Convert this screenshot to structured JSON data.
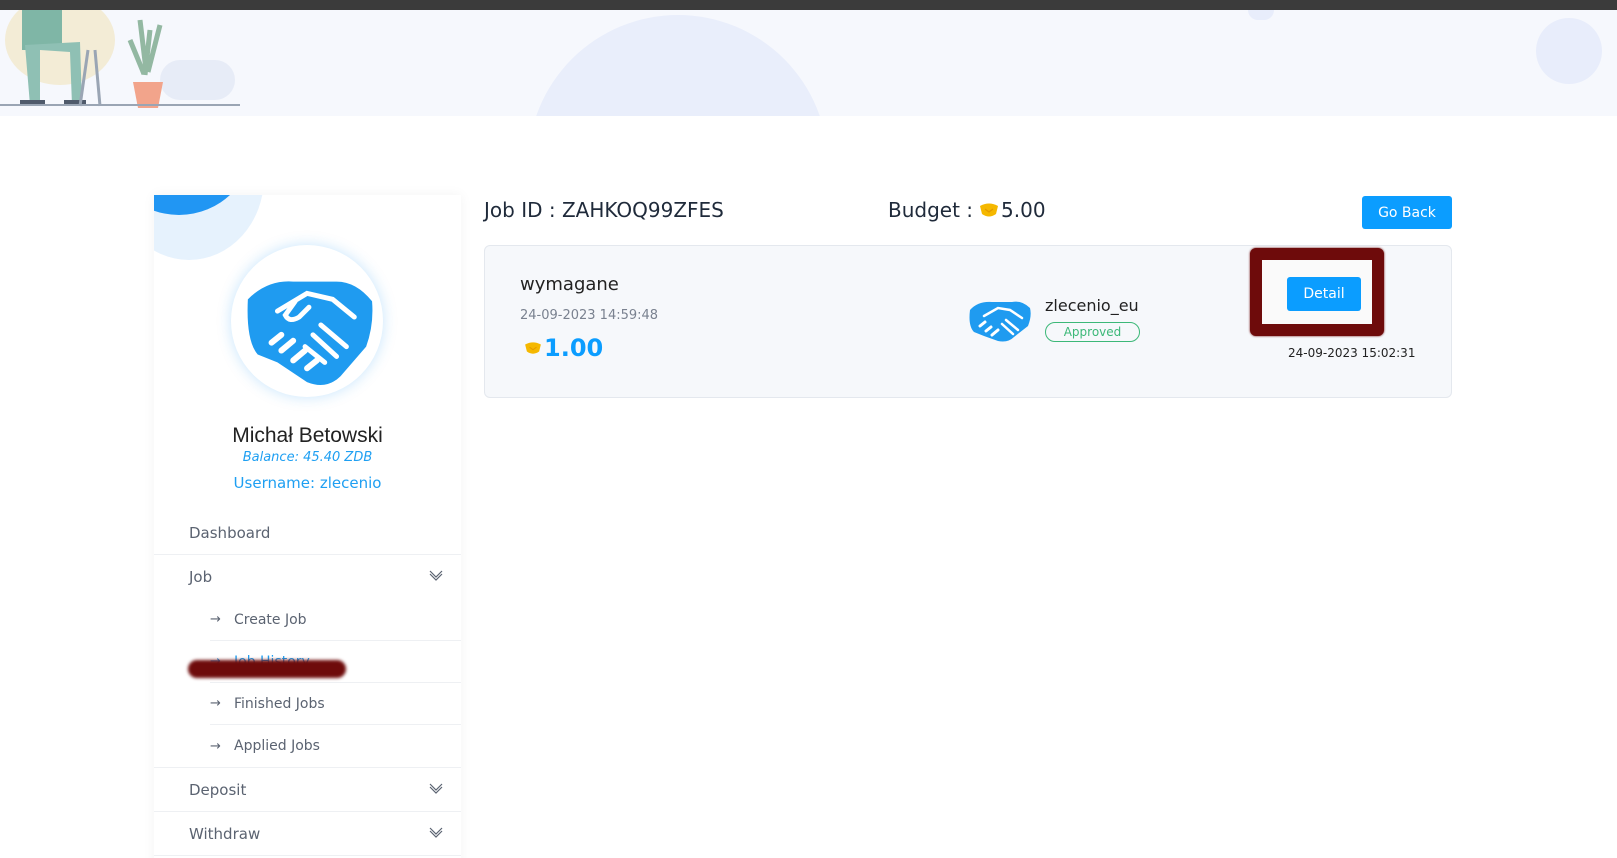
{
  "profile": {
    "name": "Michał Betowski",
    "balance": "Balance: 45.40 ZDB",
    "username": "Username: zlecenio",
    "avatar_icon": "handshake-icon"
  },
  "sidebar": {
    "dashboard": "Dashboard",
    "job": {
      "label": "Job",
      "items": [
        {
          "label": "Create Job",
          "active": false
        },
        {
          "label": "Job History",
          "active": true
        },
        {
          "label": "Finished Jobs",
          "active": false
        },
        {
          "label": "Applied Jobs",
          "active": false
        }
      ]
    },
    "deposit": "Deposit",
    "withdraw": "Withdraw",
    "arrow": "→"
  },
  "header": {
    "job_id": "Job ID : ZAHKOQ99ZFES",
    "budget_label": "Budget :",
    "budget_value": "5.00",
    "go_back": "Go Back"
  },
  "job": {
    "title": "wymagane",
    "date": "24-09-2023 14:59:48",
    "price": "1.00",
    "worker": "zlecenio_eu",
    "status": "Approved",
    "detail_label": "Detail",
    "submitted_at": "24-09-2023 15:02:31"
  },
  "colors": {
    "accent": "#0b9dff",
    "approved": "#3cb878",
    "coin": "#f5b800",
    "redaction": "#6e0b0b"
  }
}
